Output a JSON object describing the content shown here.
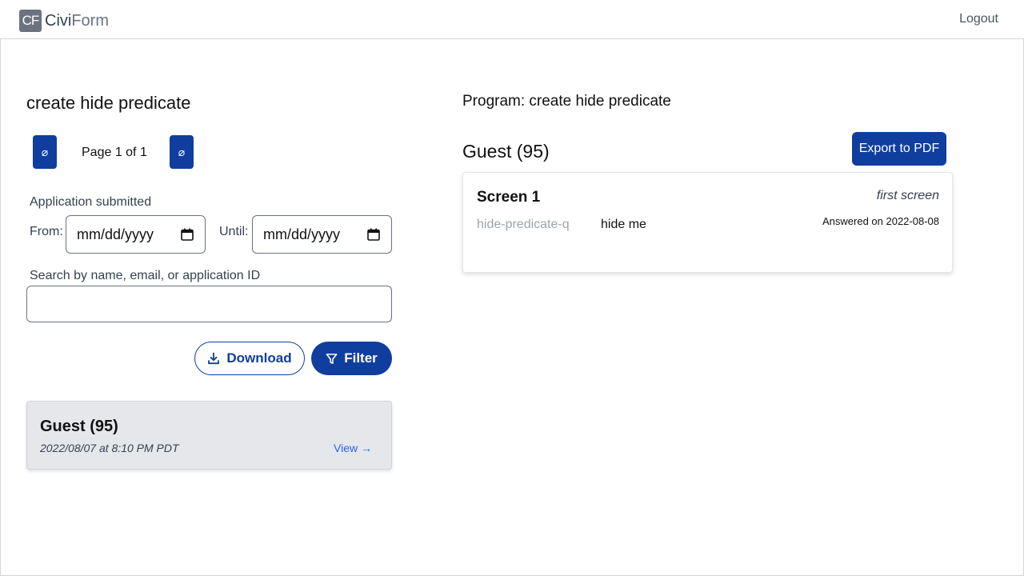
{
  "header": {
    "logo_box": "CF",
    "logo_bold": "Civi",
    "logo_light": "Form",
    "logout_label": "Logout"
  },
  "left": {
    "title": "create hide predicate",
    "pagination": {
      "prev_icon": "⌀",
      "next_icon": "⌀",
      "label": "Page 1 of 1"
    },
    "filters": {
      "submitted_label": "Application submitted",
      "from_label": "From:",
      "from_value": "mm/dd/yyyy",
      "until_label": "Until:",
      "until_value": "mm/dd/yyyy",
      "search_label": "Search by name, email, or application ID",
      "search_value": ""
    },
    "buttons": {
      "download_label": "Download",
      "filter_label": "Filter"
    },
    "applications": [
      {
        "name": "Guest (95)",
        "submitted": "2022/08/07 at 8:10 PM PDT",
        "view_label": "View →"
      }
    ]
  },
  "right": {
    "program_title": "Program: create hide predicate",
    "applicant": "Guest (95)",
    "export_label": "Export to PDF",
    "screens": [
      {
        "name": "Screen 1",
        "description": "first screen",
        "question_name": "hide-predicate-q",
        "answer": "hide me",
        "answered_on": "Answered on 2022-08-08"
      }
    ]
  },
  "colors": {
    "primary": "#0f3e9e",
    "link": "#2563eb",
    "card_bg": "#e5e7eb",
    "muted_text": "#9ca3af"
  }
}
